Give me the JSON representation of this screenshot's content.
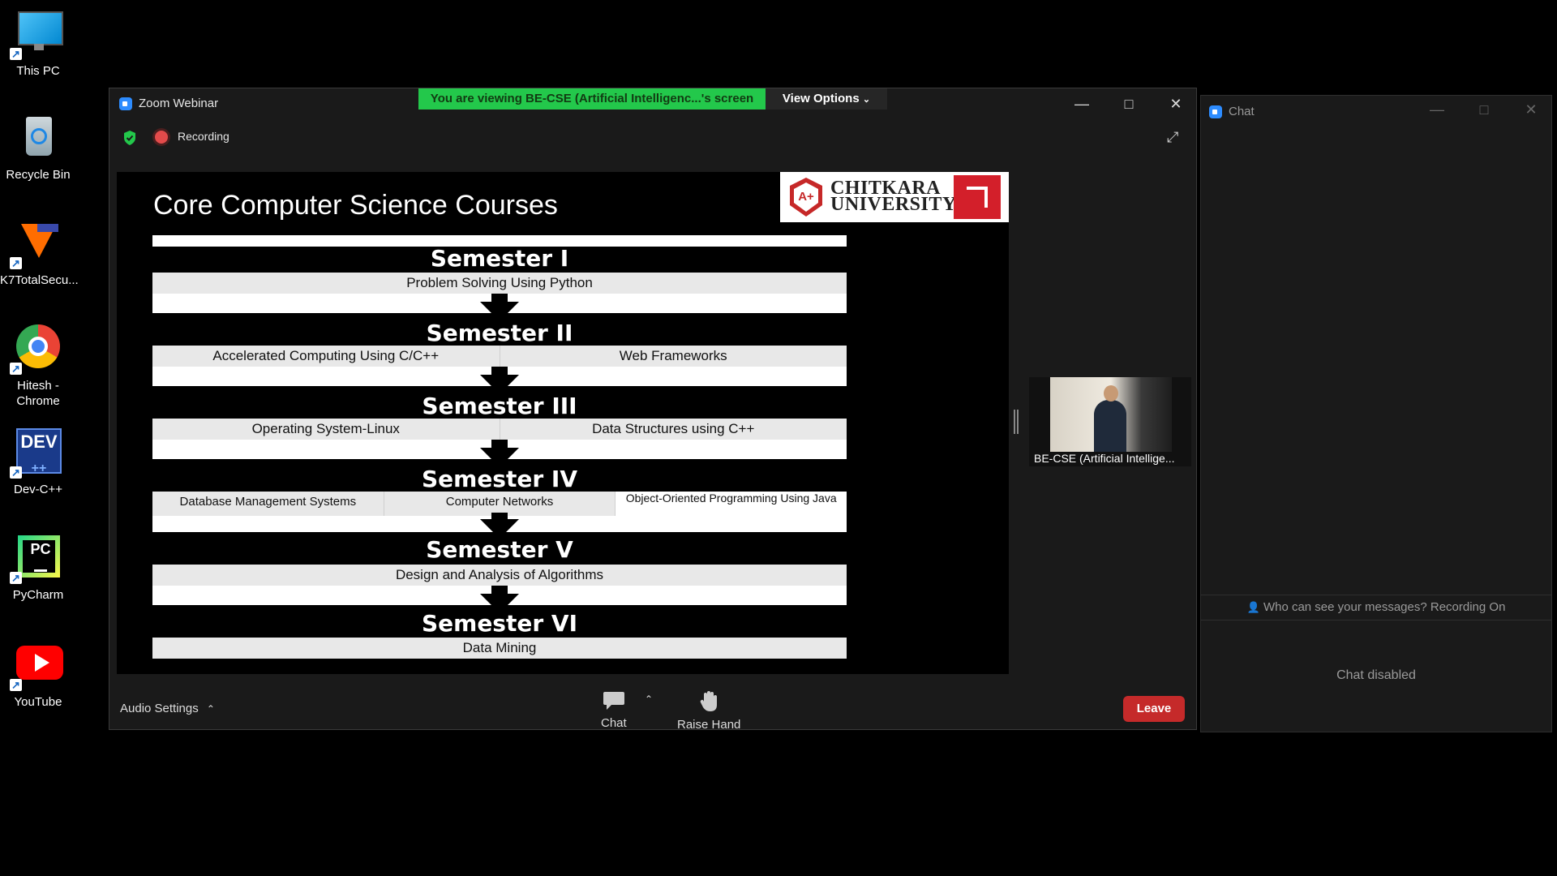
{
  "desktop": {
    "icons": [
      {
        "label": "This PC"
      },
      {
        "label": "Recycle Bin"
      },
      {
        "label": "K7TotalSecu..."
      },
      {
        "label": "Hitesh -\nChrome"
      },
      {
        "label": "Dev-C++"
      },
      {
        "label": "PyCharm"
      },
      {
        "label": "YouTube"
      }
    ]
  },
  "zoom": {
    "title": "Zoom Webinar",
    "banner": "You are viewing BE-CSE (Artificial Intelligenc...'s screen",
    "view_options": "View Options",
    "recording_label": "Recording",
    "slide": {
      "title": "Core Computer Science Courses",
      "logo_line1": "CHITKARA",
      "logo_line2": "UNIVERSITY",
      "semesters": [
        {
          "name": "Semester I",
          "courses": [
            "Problem Solving Using Python"
          ]
        },
        {
          "name": "Semester II",
          "courses": [
            "Accelerated Computing Using C/C++",
            "Web Frameworks"
          ]
        },
        {
          "name": "Semester III",
          "courses": [
            "Operating System-Linux",
            "Data Structures using C++"
          ]
        },
        {
          "name": "Semester IV",
          "courses": [
            "Database Management Systems",
            "Computer Networks",
            "Object-Oriented Programming Using Java"
          ]
        },
        {
          "name": "Semester V",
          "courses": [
            "Design and Analysis of Algorithms"
          ]
        },
        {
          "name": "Semester VI",
          "courses": [
            "Data Mining"
          ]
        }
      ]
    },
    "participant_name": "BE-CSE (Artificial Intellige...",
    "toolbar": {
      "audio_settings": "Audio Settings",
      "chat": "Chat",
      "raise_hand": "Raise Hand",
      "leave": "Leave"
    }
  },
  "chat": {
    "title": "Chat",
    "notice": "Who can see your messages? Recording On",
    "disabled": "Chat disabled"
  },
  "colors": {
    "banner_green": "#23c84b",
    "leave_red": "#c52a2a",
    "recording_red": "#e34b4b"
  }
}
